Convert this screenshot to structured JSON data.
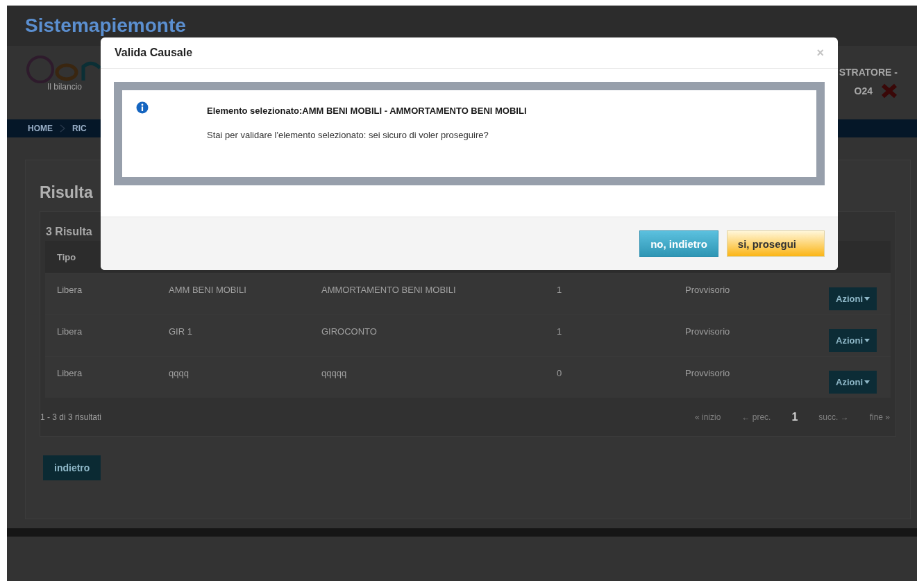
{
  "site": {
    "title": "Sistemapiemonte",
    "tagline": "Il bilancio",
    "user_line_1": "STRATORE -",
    "user_line_2": "O24"
  },
  "breadcrumb": [
    "HOME",
    "RIC"
  ],
  "page": {
    "heading": "Risulta",
    "results_title": "3 Risulta",
    "table": {
      "columns": [
        "Tipo"
      ],
      "rows": [
        {
          "tipo": "Libera",
          "codice": "AMM BENI MOBILI",
          "descrizione": "AMMORTAMENTO BENI MOBILI",
          "conti": "1",
          "stato": "Provvisorio",
          "action": "Azioni"
        },
        {
          "tipo": "Libera",
          "codice": "GIR 1",
          "descrizione": "GIROCONTO",
          "conti": "1",
          "stato": "Provvisorio",
          "action": "Azioni"
        },
        {
          "tipo": "Libera",
          "codice": "qqqq",
          "descrizione": "qqqqq",
          "conti": "0",
          "stato": "Provvisorio",
          "action": "Azioni"
        }
      ]
    },
    "summary": "1 - 3 di 3 risultati",
    "pagination": [
      {
        "label": "« inizio",
        "selected": false
      },
      {
        "label": "← prec.",
        "selected": false
      },
      {
        "label": "1",
        "selected": true
      },
      {
        "label": "succ. →",
        "selected": false
      },
      {
        "label": "fine »",
        "selected": false
      }
    ],
    "back_button": "indietro"
  },
  "dialog": {
    "title": "Valida Causale",
    "close": "×",
    "message_title": "Elemento selezionato:AMM BENI MOBILI - AMMORTAMENTO BENI MOBILI",
    "message": "Stai per validare l'elemento selezionato: sei sicuro di voler proseguire?",
    "buttons": [
      {
        "label": "no, indietro",
        "kind": "secondary"
      },
      {
        "label": "si, prosegui",
        "kind": "primary"
      }
    ]
  }
}
